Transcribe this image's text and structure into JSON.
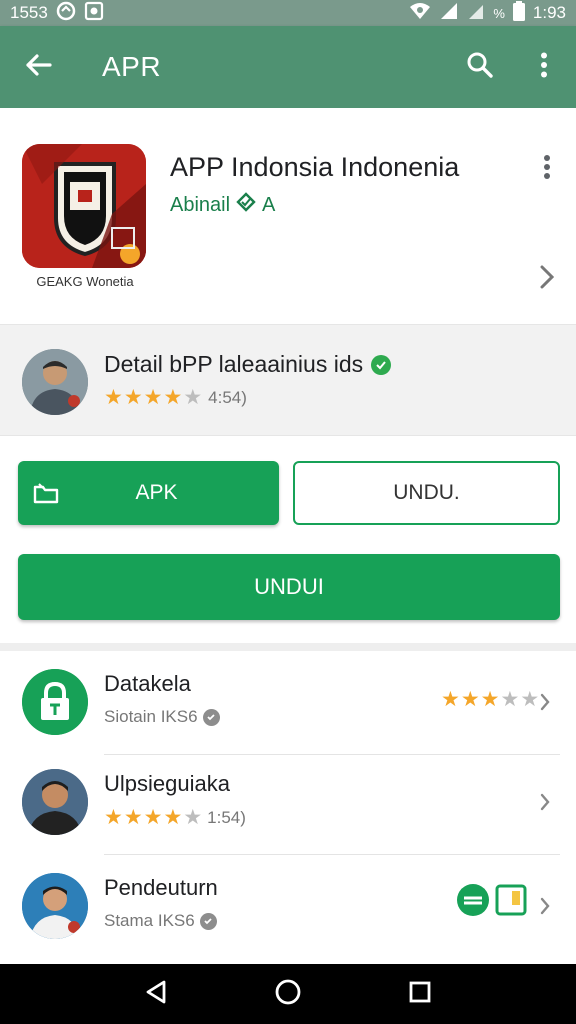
{
  "status_bar": {
    "time_left": "1553",
    "battery_pct": "%",
    "time_right": "1:93"
  },
  "app_bar": {
    "title": "APR"
  },
  "app": {
    "name": "APP Indonsia Indonenia",
    "developer": "Abinail",
    "developer_suffix": "A",
    "icon_caption": "GEAKG Wonetia"
  },
  "detail": {
    "title": "Detail bPP laleaainius ids",
    "rating_text": "4:54)",
    "stars": 4
  },
  "buttons": {
    "apk_label": "APK",
    "undu_outline_label": "UNDU.",
    "undu_full_label": "UNDUI"
  },
  "list": [
    {
      "title": "Datakela",
      "subtitle": "Siotain IKS6",
      "stars": 3
    },
    {
      "title": "Ulpsieguiaka",
      "subtitle": "1:54)",
      "stars": 4
    },
    {
      "title": "Pendeuturn",
      "subtitle": "Stama IKS6"
    }
  ],
  "colors": {
    "app_bar": "#4f9272",
    "status_bar": "#7a9a8c",
    "accent_green": "#17a157",
    "star": "#f4a62a",
    "app_icon_bg": "#b8231b"
  },
  "icons": [
    "wifi-icon",
    "signal-icon",
    "battery-icon",
    "back-arrow-icon",
    "search-icon",
    "more-vert-icon",
    "chevron-right-icon",
    "verified-icon",
    "lock-icon",
    "nav-back-icon",
    "nav-home-icon",
    "nav-recents-icon"
  ]
}
